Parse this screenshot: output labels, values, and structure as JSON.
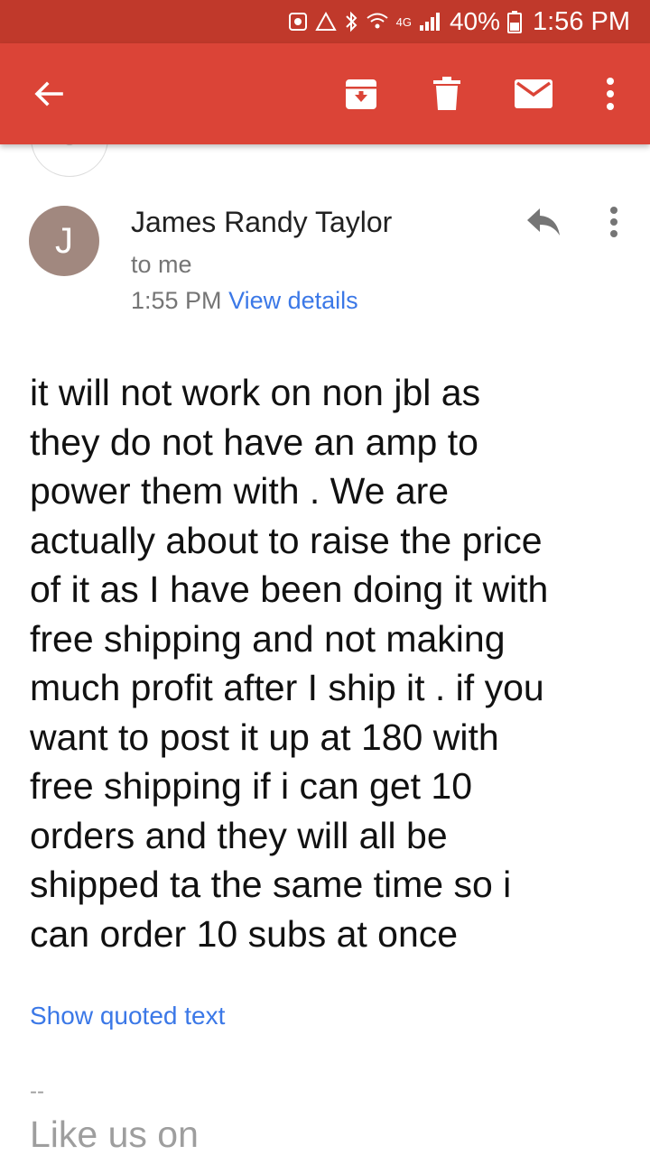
{
  "status_bar": {
    "network": "4G",
    "battery": "40%",
    "time": "1:56 PM"
  },
  "toolbar": {
    "icons": [
      "back-arrow-icon",
      "archive-icon",
      "trash-icon",
      "mail-icon",
      "more-vert-icon"
    ]
  },
  "message": {
    "sender_initial": "J",
    "sender_name": "James Randy Taylor",
    "recipient": "to me",
    "time": "1:55 PM",
    "view_details": "View details",
    "body": "it will not work on non jbl as\nthey do not have an amp to\npower them with . We are\nactually about to raise the price\nof it as I have been doing it with\nfree shipping and not making\nmuch profit after I ship it . if you\nwant to post it up at 180 with\nfree shipping if i can get 10\norders and they will all be\nshipped ta the same time so i\ncan order 10 subs at once",
    "show_quoted": "Show quoted text",
    "signature_dash": "--",
    "signature_text": "Like us on"
  },
  "colors": {
    "app_bar": "#db4437",
    "status_bar": "#c0392b",
    "link": "#3b78e7",
    "avatar": "#a1887f"
  }
}
